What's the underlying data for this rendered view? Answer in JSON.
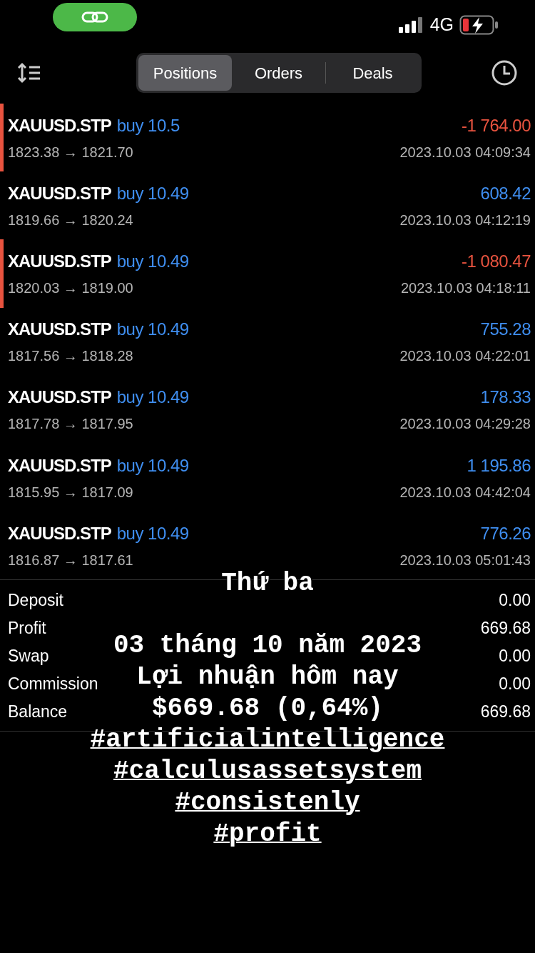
{
  "status_bar": {
    "network": "4G"
  },
  "tabs": [
    {
      "label": "Positions",
      "selected": true
    },
    {
      "label": "Orders",
      "selected": false
    },
    {
      "label": "Deals",
      "selected": false
    }
  ],
  "positions": [
    {
      "symbol": "XAUUSD.STP",
      "side": "buy 10.5",
      "prices": "1823.38 → 1821.70",
      "profit": "-1 764.00",
      "time": "2023.10.03 04:09:34",
      "loss": true
    },
    {
      "symbol": "XAUUSD.STP",
      "side": "buy 10.49",
      "prices": "1819.66 → 1820.24",
      "profit": "608.42",
      "time": "2023.10.03 04:12:19",
      "loss": false
    },
    {
      "symbol": "XAUUSD.STP",
      "side": "buy 10.49",
      "prices": "1820.03 → 1819.00",
      "profit": "-1 080.47",
      "time": "2023.10.03 04:18:11",
      "loss": true
    },
    {
      "symbol": "XAUUSD.STP",
      "side": "buy 10.49",
      "prices": "1817.56 → 1818.28",
      "profit": "755.28",
      "time": "2023.10.03 04:22:01",
      "loss": false
    },
    {
      "symbol": "XAUUSD.STP",
      "side": "buy 10.49",
      "prices": "1817.78 → 1817.95",
      "profit": "178.33",
      "time": "2023.10.03 04:29:28",
      "loss": false
    },
    {
      "symbol": "XAUUSD.STP",
      "side": "buy 10.49",
      "prices": "1815.95 → 1817.09",
      "profit": "1 195.86",
      "time": "2023.10.03 04:42:04",
      "loss": false
    },
    {
      "symbol": "XAUUSD.STP",
      "side": "buy 10.49",
      "prices": "1816.87 → 1817.61",
      "profit": "776.26",
      "time": "2023.10.03 05:01:43",
      "loss": false
    }
  ],
  "summary": [
    {
      "label": "Deposit",
      "value": "0.00"
    },
    {
      "label": "Profit",
      "value": "669.68"
    },
    {
      "label": "Swap",
      "value": "0.00"
    },
    {
      "label": "Commission",
      "value": "0.00"
    },
    {
      "label": "Balance",
      "value": "669.68"
    }
  ],
  "overlay": {
    "day": "Thứ ba",
    "lines": [
      "03 tháng 10 năm 2023",
      "Lợi nhuận hôm nay",
      "$669.68 (0,64%)"
    ],
    "hashtags": [
      "#artificialintelligence",
      "#calculusassetsystem",
      "#consistenly",
      "#profit"
    ]
  }
}
